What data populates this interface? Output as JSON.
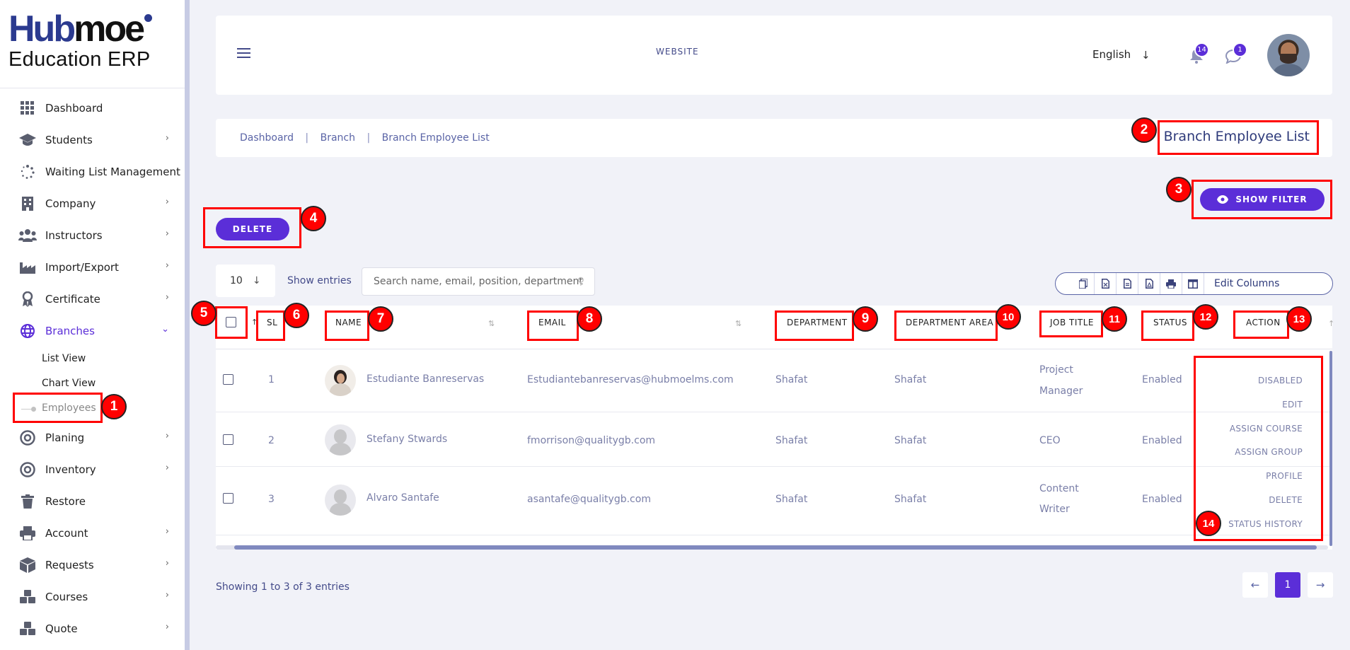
{
  "logo": {
    "part1": "Hub",
    "part2": "moe",
    "subtitle": "Education ERP"
  },
  "sidebar": {
    "items": [
      {
        "label": "Dashboard",
        "icon": "grid-icon"
      },
      {
        "label": "Students",
        "icon": "graduation-cap-icon"
      },
      {
        "label": "Waiting List Management",
        "icon": "spinner-icon"
      },
      {
        "label": "Company",
        "icon": "building-icon"
      },
      {
        "label": "Instructors",
        "icon": "users-icon"
      },
      {
        "label": "Import/Export",
        "icon": "industry-icon"
      },
      {
        "label": "Certificate",
        "icon": "award-icon"
      },
      {
        "label": "Branches",
        "icon": "globe-icon"
      },
      {
        "label": "Planing",
        "icon": "target-icon"
      },
      {
        "label": "Inventory",
        "icon": "target-icon"
      },
      {
        "label": "Restore",
        "icon": "trash-icon"
      },
      {
        "label": "Account",
        "icon": "printer-icon"
      },
      {
        "label": "Requests",
        "icon": "box-icon"
      },
      {
        "label": "Courses",
        "icon": "cubes-icon"
      },
      {
        "label": "Quote",
        "icon": "cubes-icon"
      }
    ],
    "branches_sub": [
      "List View",
      "Chart View",
      "Employees"
    ]
  },
  "header": {
    "website": "WEBSITE",
    "language": "English",
    "notifications_count": "14",
    "messages_count": "1"
  },
  "breadcrumb": {
    "items": [
      "Dashboard",
      "Branch",
      "Branch Employee List"
    ],
    "separator": "|"
  },
  "page_title": "Branch Employee List",
  "buttons": {
    "show_filter": "SHOW FILTER",
    "delete": "DELETE"
  },
  "table_controls": {
    "page_length": "10",
    "show_entries": "Show entries",
    "search_placeholder": "Search name, email, position, department",
    "edit_columns": "Edit Columns"
  },
  "table": {
    "columns": [
      "SL",
      "NAME",
      "EMAIL",
      "DEPARTMENT",
      "DEPARTMENT AREA",
      "JOB TITLE",
      "STATUS",
      "ACTION"
    ],
    "rows": [
      {
        "sl": "1",
        "name": "Estudiante Banreservas",
        "email": "Estudiantebanreservas@hubmoelms.com",
        "department": "Shafat",
        "area": "Shafat",
        "job1": "Project",
        "job2": "Manager",
        "status": "Enabled"
      },
      {
        "sl": "2",
        "name": "Stefany Stwards",
        "email": "fmorrison@qualitygb.com",
        "department": "Shafat",
        "area": "Shafat",
        "job1": "CEO",
        "job2": "",
        "status": "Enabled"
      },
      {
        "sl": "3",
        "name": "Alvaro Santafe",
        "email": "asantafe@qualitygb.com",
        "department": "Shafat",
        "area": "Shafat",
        "job1": "Content",
        "job2": "Writer",
        "status": "Enabled"
      }
    ],
    "action_menu": [
      "DISABLED",
      "EDIT",
      "ASSIGN COURSE",
      "ASSIGN GROUP",
      "PROFILE",
      "DELETE",
      "STATUS HISTORY"
    ]
  },
  "footer": {
    "showing": "Showing 1 to 3 of 3 entries",
    "current_page": "1"
  },
  "annotations": [
    "1",
    "2",
    "3",
    "4",
    "5",
    "6",
    "7",
    "8",
    "9",
    "10",
    "11",
    "12",
    "13",
    "14"
  ],
  "colors": {
    "accent": "#5b2ed8",
    "annotation": "#ff0000",
    "link": "#444b8a"
  }
}
